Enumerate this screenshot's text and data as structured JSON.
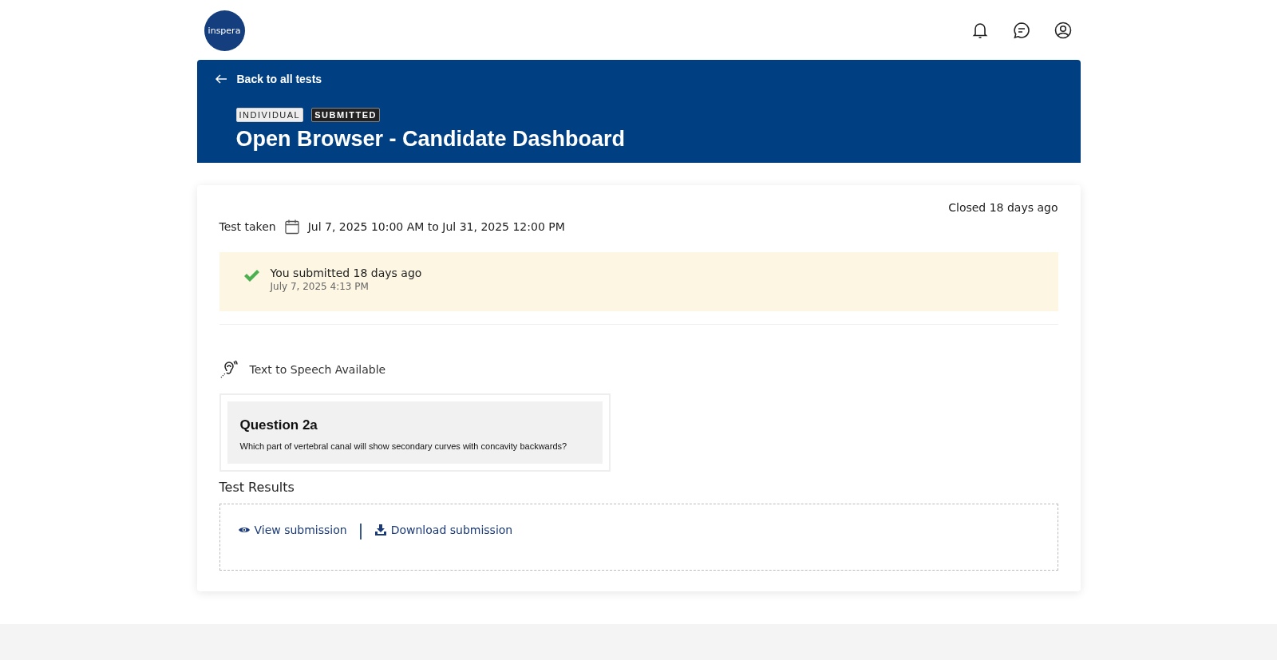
{
  "logo": {
    "text": "inspera"
  },
  "header": {
    "back_link": "Back to all tests",
    "tags": [
      {
        "label": "INDIVIDUAL",
        "kind": "light"
      },
      {
        "label": "SUBMITTED",
        "kind": "dark"
      }
    ],
    "title": "Open Browser - Candidate Dashboard"
  },
  "details": {
    "closed": "Closed 18 days ago",
    "test_taken_label": "Test taken",
    "test_taken_range": "Jul 7, 2025 10:00 AM to Jul 31, 2025 12:00 PM"
  },
  "submission_notice": {
    "message": "You submitted 18 days ago",
    "timestamp": "July 7, 2025 4:13 PM"
  },
  "accessibility": {
    "label": "Text to Speech Available"
  },
  "question_preview": {
    "title": "Question 2a",
    "text": "Which part of vertebral canal will show secondary curves with concavity backwards?"
  },
  "results": {
    "heading": "Test Results",
    "actions": [
      {
        "label": "View submission",
        "kind": "view"
      },
      {
        "label": "Download submission",
        "kind": "download"
      }
    ]
  }
}
